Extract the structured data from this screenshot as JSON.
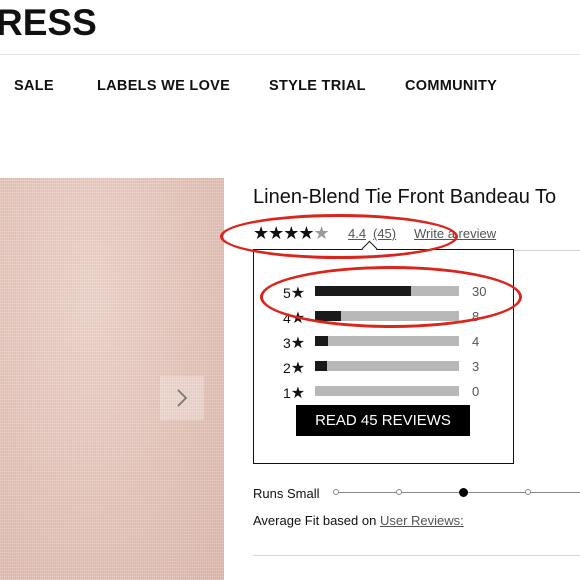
{
  "header": {
    "brand": "RESS",
    "nav": [
      "SALE",
      "LABELS WE LOVE",
      "STYLE TRIAL",
      "COMMUNITY"
    ]
  },
  "product": {
    "title": "Linen-Blend Tie Front Bandeau To",
    "rating_stars": "★★★★",
    "rating_half": "★",
    "average": "4.4",
    "review_count": "(45)",
    "write_review": "Write a review"
  },
  "breakdown": {
    "rows": [
      {
        "stars": "5",
        "count": "30",
        "fraction": 0.667
      },
      {
        "stars": "4",
        "count": "8",
        "fraction": 0.178
      },
      {
        "stars": "3",
        "count": "4",
        "fraction": 0.089
      },
      {
        "stars": "2",
        "count": "3",
        "fraction": 0.067
      },
      {
        "stars": "1",
        "count": "0",
        "fraction": 0.0
      }
    ],
    "read_button": "READ 45 REVIEWS"
  },
  "fit": {
    "label": "Runs Small",
    "selected_index": 2,
    "average_fit_text": "Average Fit based on ",
    "user_reviews_link": "User Reviews:"
  },
  "icons": {
    "next": "chevron-right-icon",
    "star": "star-icon"
  },
  "colors": {
    "annotation_red": "#d9251c",
    "bar_fill": "#1a1a1a",
    "bar_track": "#b8b8b8",
    "button_bg": "#000000"
  }
}
